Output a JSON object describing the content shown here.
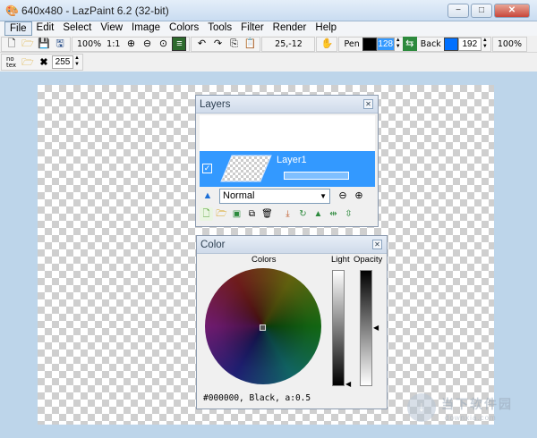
{
  "window": {
    "title": "640x480 - LazPaint 6.2 (32-bit)",
    "min_label": "▭",
    "max_label": "□",
    "close_label": "✕"
  },
  "menu": [
    "File",
    "Edit",
    "Select",
    "View",
    "Image",
    "Colors",
    "Tools",
    "Filter",
    "Render",
    "Help"
  ],
  "toolbar": {
    "zoom_percent": "100%",
    "zoom_ratio": "1:1",
    "coords": "25,-12",
    "pen_label": "Pen",
    "pen_value": "128",
    "back_label": "Back",
    "back_value": "192",
    "opacity_percent": "100%",
    "no_tex_label": "no\ntex",
    "tex_value": "255"
  },
  "layers_panel": {
    "title": "Layers",
    "layer_name": "Layer1",
    "blend_mode": "Normal",
    "visible_check": "☑"
  },
  "color_panel": {
    "title": "Color",
    "colors_label": "Colors",
    "light_label": "Light",
    "opacity_label": "Opacity",
    "status": "#000000, Black, a:0.5"
  },
  "watermark": {
    "text": "当下软件园",
    "sub": "downxia.com"
  },
  "colors": {
    "accent": "#3399ff",
    "pen": "#000000",
    "back": "#0070ff"
  }
}
